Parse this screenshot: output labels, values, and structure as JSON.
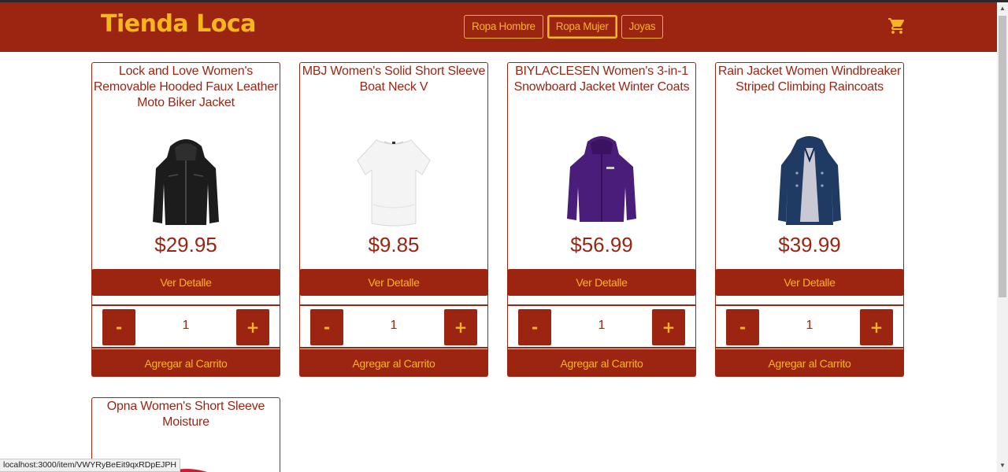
{
  "brand": "Tienda Loca",
  "nav": [
    {
      "label": "Ropa Hombre"
    },
    {
      "label": "Ropa Mujer"
    },
    {
      "label": "Joyas"
    }
  ],
  "cart_icon": "shopping-cart-icon",
  "colors": {
    "primary": "#9c2512",
    "accent": "#f7b51e"
  },
  "products": [
    {
      "title": "Lock and Love Women's Removable Hooded Faux Leather Moto Biker Jacket",
      "price": "$29.95",
      "detail": "Ver Detalle",
      "qty": "1",
      "add": "Agregar al Carrito",
      "image": "black-leather-jacket"
    },
    {
      "title": "MBJ Women's Solid Short Sleeve Boat Neck V",
      "price": "$9.85",
      "detail": "Ver Detalle",
      "qty": "1",
      "add": "Agregar al Carrito",
      "image": "white-t-shirt"
    },
    {
      "title": "BIYLACLESEN Women's 3-in-1 Snowboard Jacket Winter Coats",
      "price": "$56.99",
      "detail": "Ver Detalle",
      "qty": "1",
      "add": "Agregar al Carrito",
      "image": "purple-winter-jacket"
    },
    {
      "title": "Rain Jacket Women Windbreaker Striped Climbing Raincoats",
      "price": "$39.99",
      "detail": "Ver Detalle",
      "qty": "1",
      "add": "Agregar al Carrito",
      "image": "navy-raincoat"
    },
    {
      "title": "Opna Women's Short Sleeve Moisture",
      "image": "red-t-shirt"
    }
  ],
  "qty_minus": "-",
  "qty_plus": "+",
  "status_url": "localhost:3000/item/VWYRyBeEit9qxRDpEJPH"
}
